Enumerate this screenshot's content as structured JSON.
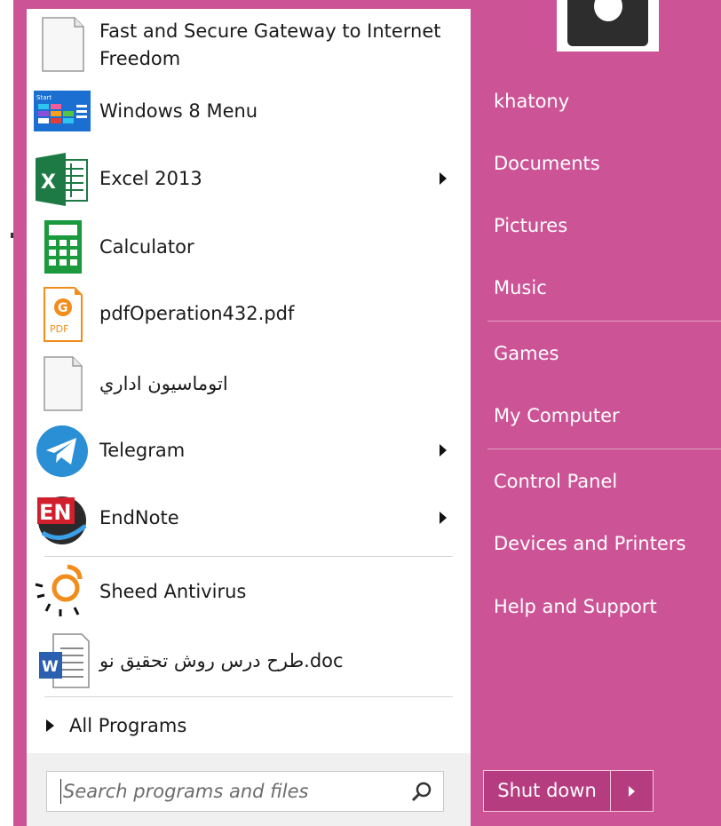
{
  "programs": [
    {
      "label_lines": [
        "Fast and Secure Gateway to Internet",
        "Freedom"
      ],
      "icon": "blank-document-icon",
      "has_submenu": false
    },
    {
      "label": "Windows 8 Menu",
      "icon": "windows8-menu-icon",
      "has_submenu": false
    },
    {
      "label": "Excel 2013",
      "icon": "excel-icon",
      "has_submenu": true
    },
    {
      "label": "Calculator",
      "icon": "calculator-icon",
      "has_submenu": false
    },
    {
      "label": "pdfOperation432.pdf",
      "icon": "foxit-pdf-icon",
      "has_submenu": false
    },
    {
      "label": "اتوماسیون اداري",
      "icon": "blank-document-icon",
      "has_submenu": false
    },
    {
      "label": "Telegram",
      "icon": "telegram-icon",
      "has_submenu": true
    },
    {
      "label": "EndNote",
      "icon": "endnote-icon",
      "has_submenu": true
    },
    {
      "label": "Sheed Antivirus",
      "icon": "sheed-antivirus-icon",
      "has_submenu": false
    },
    {
      "label": "طرح درس روش تحقيق نو.doc",
      "icon": "word-document-icon",
      "has_submenu": false
    }
  ],
  "all_programs_label": "All Programs",
  "search": {
    "placeholder": "Search programs and files",
    "icon": "search-icon"
  },
  "user": {
    "name": "khatony",
    "avatar_icon": "user-avatar-icon"
  },
  "right_links": [
    "Documents",
    "Pictures",
    "Music",
    "Games",
    "My Computer",
    "Control Panel",
    "Devices and Printers",
    "Help and Support"
  ],
  "shutdown": {
    "label": "Shut down",
    "options_icon": "triangle-right-icon"
  },
  "colors": {
    "accent": "#cc5496",
    "shutdown_bg": "#b63c80",
    "panel": "#ffffff",
    "search_area": "#f0f0f0"
  }
}
